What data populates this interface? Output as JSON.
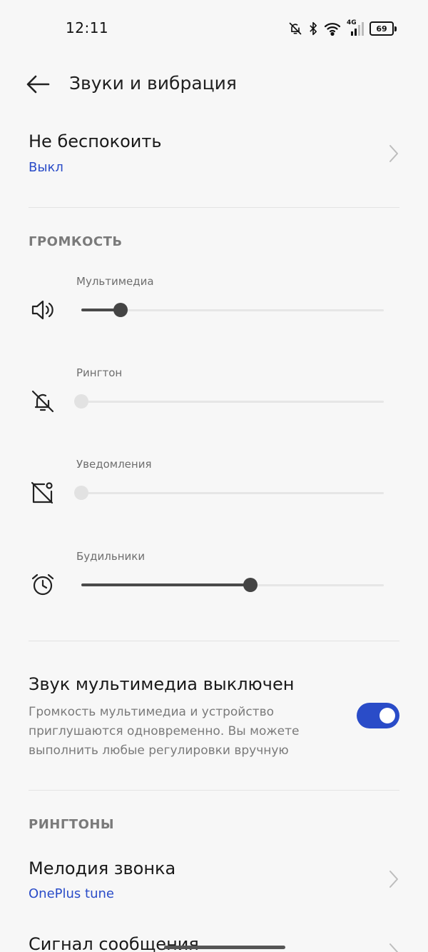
{
  "status": {
    "time": "12:11",
    "network": "4G",
    "battery": "69"
  },
  "header": {
    "title": "Звуки и вибрация",
    "back_icon": "arrow-left-icon"
  },
  "dnd": {
    "title": "Не беспокоить",
    "value": "Выкл"
  },
  "volume_section": {
    "title": "ГРОМКОСТЬ",
    "sliders": [
      {
        "label": "Мультимедиа",
        "icon": "speaker-icon",
        "level": 0.13,
        "enabled": true
      },
      {
        "label": "Рингтон",
        "icon": "bell-off-icon",
        "level": 0.0,
        "enabled": false
      },
      {
        "label": "Уведомления",
        "icon": "notification-off-icon",
        "level": 0.0,
        "enabled": false
      },
      {
        "label": "Будильники",
        "icon": "alarm-clock-icon",
        "level": 0.56,
        "enabled": true
      }
    ]
  },
  "mute_toggle": {
    "title": "Звук мультимедиа выключен",
    "description": "Громкость мультимедиа и устройство приглушаются одновременно. Вы можете выполнить любые регулировки вручную",
    "on": true,
    "accent": "#2a4cc8"
  },
  "ringtones_section": {
    "title": "РИНГТОНЫ",
    "items": [
      {
        "title": "Мелодия звонка",
        "value": "OnePlus tune"
      },
      {
        "title": "Сигнал сообщения",
        "value": ""
      }
    ]
  }
}
